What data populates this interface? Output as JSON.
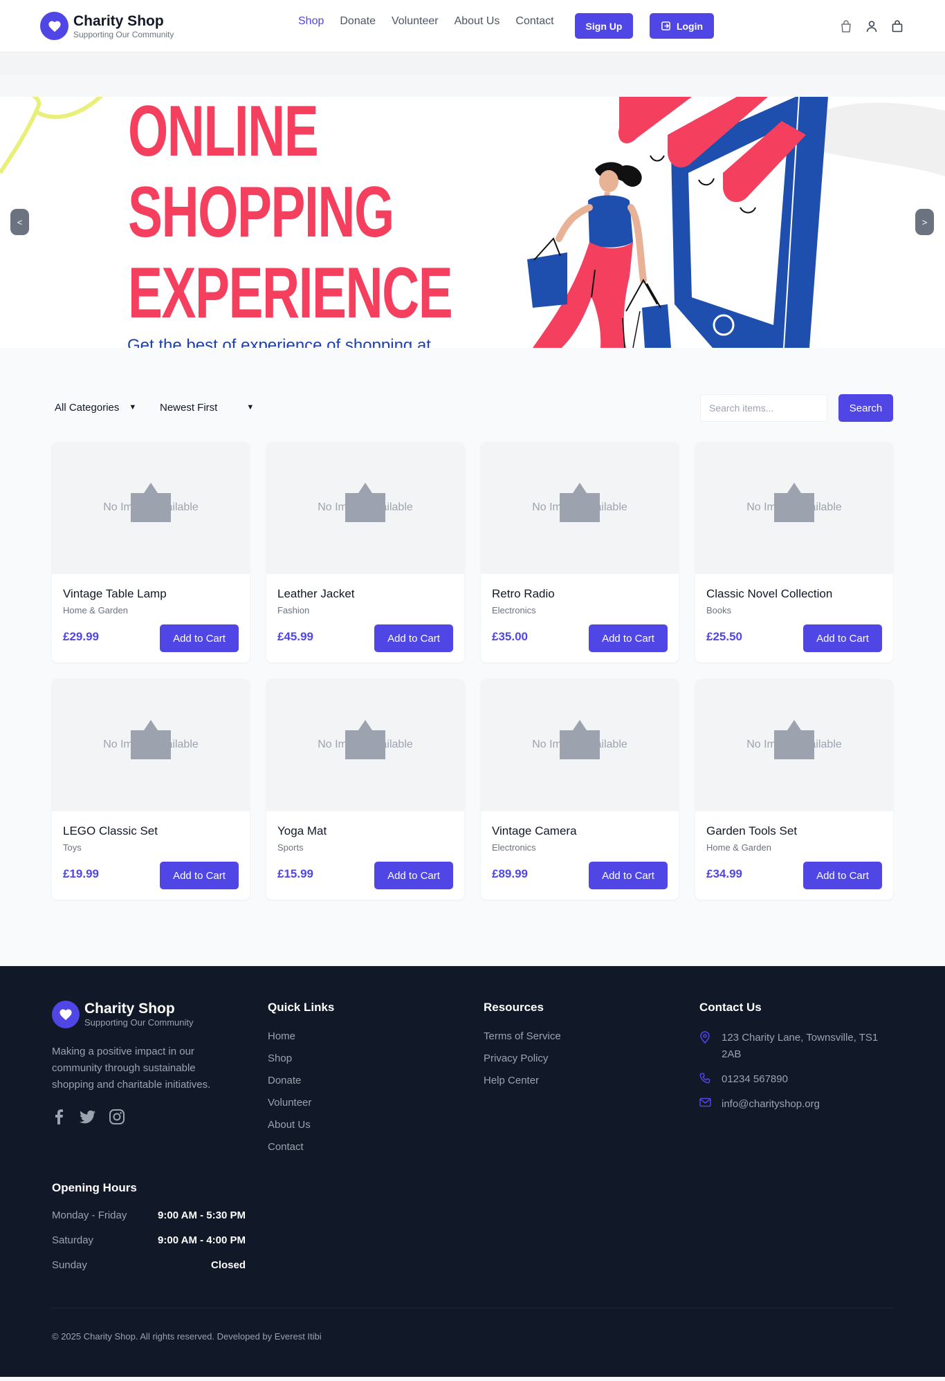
{
  "header": {
    "brand_name": "Charity Shop",
    "brand_tagline": "Supporting Our Community",
    "nav": [
      "Shop",
      "Donate",
      "Volunteer",
      "About Us",
      "Contact"
    ],
    "active_nav": "Shop",
    "signup_label": "Sign Up",
    "login_label": "Login",
    "icons": [
      "shopping-bag-icon",
      "user-icon",
      "cart-icon"
    ]
  },
  "hero": {
    "title_lines": [
      "ONLINE",
      "SHOPPING",
      "EXPERIENCE"
    ],
    "subtitle": "Get the best of experience of shopping at",
    "prev_label": "<",
    "next_label": ">"
  },
  "filters": {
    "category": "All Categories",
    "sort": "Newest First",
    "search_placeholder": "Search items...",
    "search_label": "Search"
  },
  "products": {
    "no_image_text": "No Image Available",
    "add_to_cart_label": "Add to Cart",
    "items": [
      {
        "name": "Vintage Table Lamp",
        "category": "Home & Garden",
        "price": "£29.99"
      },
      {
        "name": "Leather Jacket",
        "category": "Fashion",
        "price": "£45.99"
      },
      {
        "name": "Retro Radio",
        "category": "Electronics",
        "price": "£35.00"
      },
      {
        "name": "Classic Novel Collection",
        "category": "Books",
        "price": "£25.50"
      },
      {
        "name": "LEGO Classic Set",
        "category": "Toys",
        "price": "£19.99"
      },
      {
        "name": "Yoga Mat",
        "category": "Sports",
        "price": "£15.99"
      },
      {
        "name": "Vintage Camera",
        "category": "Electronics",
        "price": "£89.99"
      },
      {
        "name": "Garden Tools Set",
        "category": "Home & Garden",
        "price": "£34.99"
      }
    ]
  },
  "footer": {
    "brand_name": "Charity Shop",
    "brand_tagline": "Supporting Our Community",
    "description": "Making a positive impact in our community through sustainable shopping and charitable initiatives.",
    "quick_links_title": "Quick Links",
    "quick_links": [
      "Home",
      "Shop",
      "Donate",
      "Volunteer",
      "About Us",
      "Contact"
    ],
    "resources_title": "Resources",
    "resources": [
      "Terms of Service",
      "Privacy Policy",
      "Help Center"
    ],
    "contact_title": "Contact Us",
    "address": "123 Charity Lane, Townsville, TS1 2AB",
    "phone": "01234 567890",
    "email": "info@charityshop.org",
    "hours_title": "Opening Hours",
    "hours": [
      {
        "day": "Monday - Friday",
        "time": "9:00 AM - 5:30 PM"
      },
      {
        "day": "Saturday",
        "time": "9:00 AM - 4:00 PM"
      },
      {
        "day": "Sunday",
        "time": "Closed"
      }
    ],
    "copyright": "© 2025 Charity Shop. All rights reserved. Developed by Everest Itibi"
  },
  "colors": {
    "accent": "#4f46e5",
    "hero_title": "#f43f5e",
    "hero_blue": "#1e40af",
    "footer_bg": "#111827"
  }
}
